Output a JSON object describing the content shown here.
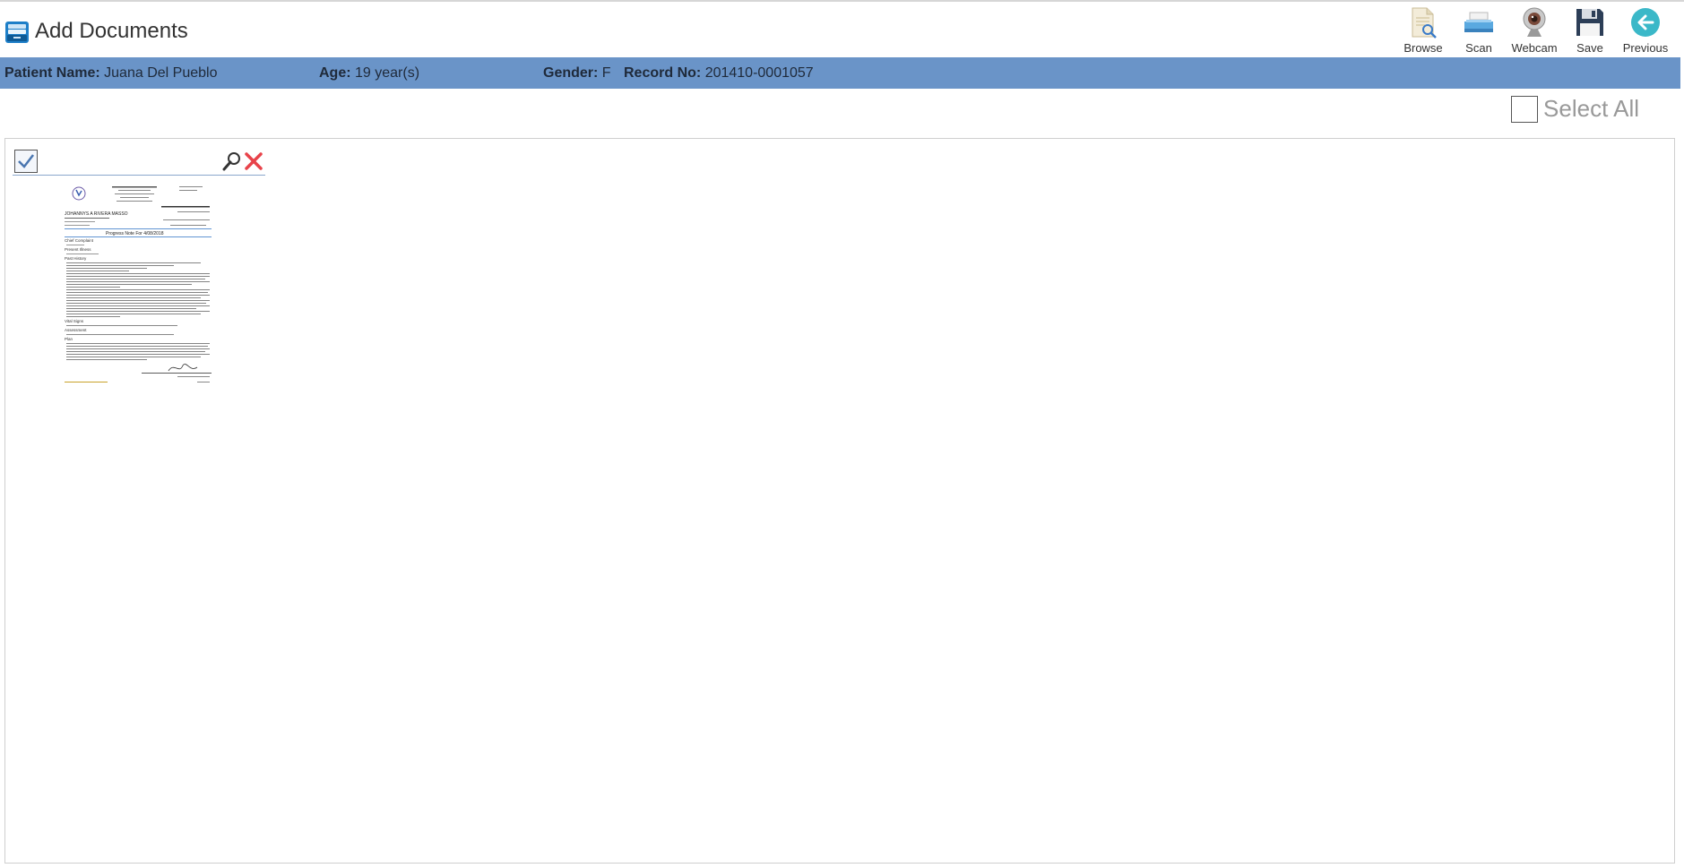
{
  "header": {
    "title": "Add Documents",
    "title_icon": "document-drawer-icon"
  },
  "toolbar": {
    "items": [
      {
        "label": "Browse",
        "icon": "browse-document-icon"
      },
      {
        "label": "Scan",
        "icon": "scanner-icon"
      },
      {
        "label": "Webcam",
        "icon": "webcam-icon"
      },
      {
        "label": "Save",
        "icon": "floppy-disk-icon"
      },
      {
        "label": "Previous",
        "icon": "arrow-left-circle-icon"
      }
    ]
  },
  "patient": {
    "name_label": "Patient Name:",
    "name": "Juana Del Pueblo",
    "age_label": "Age:",
    "age": "19 year(s)",
    "gender_label": "Gender:",
    "gender": "F",
    "record_label": "Record No:",
    "record": "201410-0001057"
  },
  "select_all": {
    "label": "Select All",
    "checked": false
  },
  "documents": [
    {
      "checked": true,
      "thumb": {
        "patient": "JOHANNYS A RIVERA MASSO",
        "heading": "Progress Note For 4/08/2018",
        "sections": [
          "Chief Complaint",
          "Present Illness",
          "Past History",
          "Vital Signs",
          "Assessment",
          "Plan"
        ]
      }
    }
  ],
  "colors": {
    "patient_bar": "#6a94c8",
    "accent": "#2f5f9e",
    "delete": "#e8434a",
    "previous": "#3bb8c8"
  }
}
